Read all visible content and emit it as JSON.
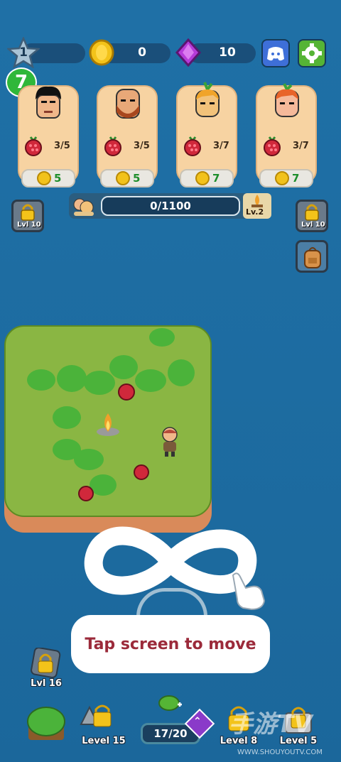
{
  "top_bar": {
    "level": "1",
    "coins": "0",
    "gems": "10"
  },
  "badge_number": "7",
  "workers": [
    {
      "count": "3/5",
      "cost": "5"
    },
    {
      "count": "3/5",
      "cost": "5"
    },
    {
      "count": "3/7",
      "cost": "7"
    },
    {
      "count": "3/7",
      "cost": "7"
    }
  ],
  "progress": {
    "text": "0/1100",
    "fraction": 0.0,
    "level_label": "Lv.2"
  },
  "locks": {
    "left_top": "Lvl 10",
    "right_top": "Lvl 10",
    "left_bottom": "Lvl 16"
  },
  "tutorial": {
    "text": "Tap screen to move"
  },
  "bottom_bar": {
    "slot2": "Level 15",
    "counter": "17/20",
    "slot4": "Level 8",
    "slot5": "Level 5"
  },
  "watermark": {
    "big": "手游TV",
    "small": "WWW.SHOUYOUTV.COM"
  },
  "colors": {
    "ocean": "#1f6ea3",
    "island_top": "#8ab643",
    "card": "#f7d3a2",
    "accent_green": "#1e8e2b"
  }
}
